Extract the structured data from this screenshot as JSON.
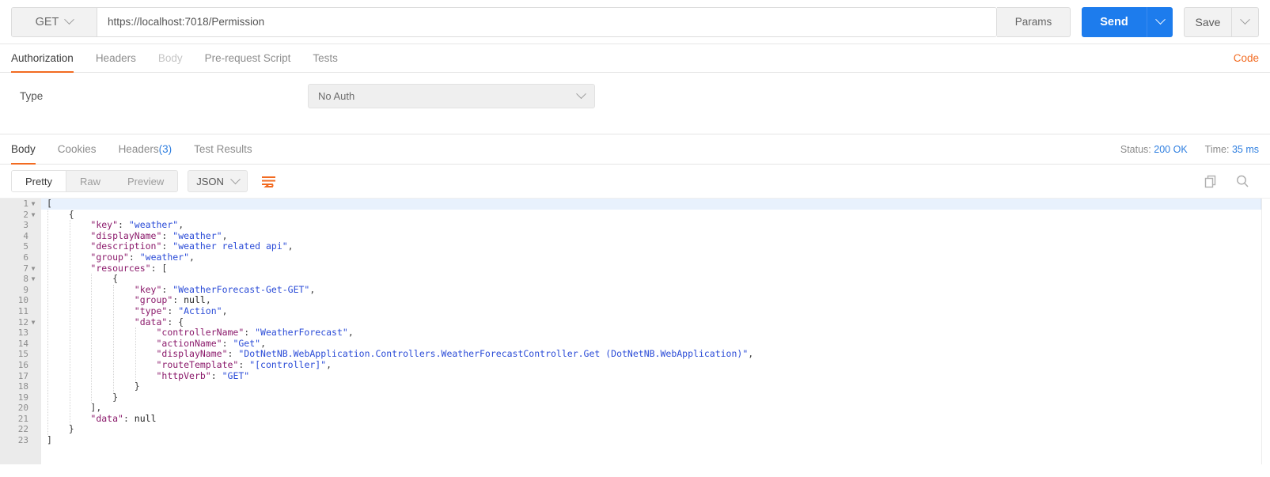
{
  "request": {
    "method": "GET",
    "url": "https://localhost:7018/Permission",
    "params_label": "Params",
    "send_label": "Send",
    "save_label": "Save"
  },
  "request_tabs": [
    {
      "label": "Authorization",
      "state": "active"
    },
    {
      "label": "Headers",
      "state": "normal"
    },
    {
      "label": "Body",
      "state": "muted"
    },
    {
      "label": "Pre-request Script",
      "state": "normal"
    },
    {
      "label": "Tests",
      "state": "normal"
    }
  ],
  "code_link": "Code",
  "auth": {
    "type_label": "Type",
    "type_value": "No Auth"
  },
  "response_tabs": [
    {
      "label": "Body",
      "state": "active",
      "count": ""
    },
    {
      "label": "Cookies",
      "state": "normal",
      "count": ""
    },
    {
      "label": "Headers",
      "state": "normal",
      "count": "(3)"
    },
    {
      "label": "Test Results",
      "state": "normal",
      "count": ""
    }
  ],
  "response_meta": {
    "status_label": "Status:",
    "status_value": "200 OK",
    "time_label": "Time:",
    "time_value": "35 ms"
  },
  "body_toolbar": {
    "views": [
      {
        "label": "Pretty",
        "state": "active"
      },
      {
        "label": "Raw",
        "state": "normal"
      },
      {
        "label": "Preview",
        "state": "normal"
      }
    ],
    "format": "JSON",
    "wrap_icon": "wrap-lines-icon",
    "copy_icon": "copy-icon",
    "search_icon": "search-icon"
  },
  "colors": {
    "accent_orange": "#f26b21",
    "send_blue": "#1d7ced",
    "link_blue": "#2f7fe0",
    "json_key": "#8b1a6b",
    "json_string": "#2a4bd7",
    "line_highlight": "#e8f1fd"
  },
  "editor": {
    "highlighted_line": 1,
    "fold_lines": [
      1,
      2,
      7,
      8,
      12
    ],
    "lines": [
      {
        "n": 1,
        "indent": 0,
        "tokens": [
          {
            "t": "p",
            "v": "["
          }
        ]
      },
      {
        "n": 2,
        "indent": 1,
        "tokens": [
          {
            "t": "p",
            "v": "{"
          }
        ]
      },
      {
        "n": 3,
        "indent": 2,
        "tokens": [
          {
            "t": "k",
            "v": "\"key\""
          },
          {
            "t": "p",
            "v": ": "
          },
          {
            "t": "s",
            "v": "\"weather\""
          },
          {
            "t": "p",
            "v": ","
          }
        ]
      },
      {
        "n": 4,
        "indent": 2,
        "tokens": [
          {
            "t": "k",
            "v": "\"displayName\""
          },
          {
            "t": "p",
            "v": ": "
          },
          {
            "t": "s",
            "v": "\"weather\""
          },
          {
            "t": "p",
            "v": ","
          }
        ]
      },
      {
        "n": 5,
        "indent": 2,
        "tokens": [
          {
            "t": "k",
            "v": "\"description\""
          },
          {
            "t": "p",
            "v": ": "
          },
          {
            "t": "s",
            "v": "\"weather related api\""
          },
          {
            "t": "p",
            "v": ","
          }
        ]
      },
      {
        "n": 6,
        "indent": 2,
        "tokens": [
          {
            "t": "k",
            "v": "\"group\""
          },
          {
            "t": "p",
            "v": ": "
          },
          {
            "t": "s",
            "v": "\"weather\""
          },
          {
            "t": "p",
            "v": ","
          }
        ]
      },
      {
        "n": 7,
        "indent": 2,
        "tokens": [
          {
            "t": "k",
            "v": "\"resources\""
          },
          {
            "t": "p",
            "v": ": ["
          }
        ]
      },
      {
        "n": 8,
        "indent": 3,
        "tokens": [
          {
            "t": "p",
            "v": "{"
          }
        ]
      },
      {
        "n": 9,
        "indent": 4,
        "tokens": [
          {
            "t": "k",
            "v": "\"key\""
          },
          {
            "t": "p",
            "v": ": "
          },
          {
            "t": "s",
            "v": "\"WeatherForecast-Get-GET\""
          },
          {
            "t": "p",
            "v": ","
          }
        ]
      },
      {
        "n": 10,
        "indent": 4,
        "tokens": [
          {
            "t": "k",
            "v": "\"group\""
          },
          {
            "t": "p",
            "v": ": "
          },
          {
            "t": "n",
            "v": "null"
          },
          {
            "t": "p",
            "v": ","
          }
        ]
      },
      {
        "n": 11,
        "indent": 4,
        "tokens": [
          {
            "t": "k",
            "v": "\"type\""
          },
          {
            "t": "p",
            "v": ": "
          },
          {
            "t": "s",
            "v": "\"Action\""
          },
          {
            "t": "p",
            "v": ","
          }
        ]
      },
      {
        "n": 12,
        "indent": 4,
        "tokens": [
          {
            "t": "k",
            "v": "\"data\""
          },
          {
            "t": "p",
            "v": ": {"
          }
        ]
      },
      {
        "n": 13,
        "indent": 5,
        "tokens": [
          {
            "t": "k",
            "v": "\"controllerName\""
          },
          {
            "t": "p",
            "v": ": "
          },
          {
            "t": "s",
            "v": "\"WeatherForecast\""
          },
          {
            "t": "p",
            "v": ","
          }
        ]
      },
      {
        "n": 14,
        "indent": 5,
        "tokens": [
          {
            "t": "k",
            "v": "\"actionName\""
          },
          {
            "t": "p",
            "v": ": "
          },
          {
            "t": "s",
            "v": "\"Get\""
          },
          {
            "t": "p",
            "v": ","
          }
        ]
      },
      {
        "n": 15,
        "indent": 5,
        "tokens": [
          {
            "t": "k",
            "v": "\"displayName\""
          },
          {
            "t": "p",
            "v": ": "
          },
          {
            "t": "s",
            "v": "\"DotNetNB.WebApplication.Controllers.WeatherForecastController.Get (DotNetNB.WebApplication)\""
          },
          {
            "t": "p",
            "v": ","
          }
        ]
      },
      {
        "n": 16,
        "indent": 5,
        "tokens": [
          {
            "t": "k",
            "v": "\"routeTemplate\""
          },
          {
            "t": "p",
            "v": ": "
          },
          {
            "t": "s",
            "v": "\"[controller]\""
          },
          {
            "t": "p",
            "v": ","
          }
        ]
      },
      {
        "n": 17,
        "indent": 5,
        "tokens": [
          {
            "t": "k",
            "v": "\"httpVerb\""
          },
          {
            "t": "p",
            "v": ": "
          },
          {
            "t": "s",
            "v": "\"GET\""
          }
        ]
      },
      {
        "n": 18,
        "indent": 4,
        "tokens": [
          {
            "t": "p",
            "v": "}"
          }
        ]
      },
      {
        "n": 19,
        "indent": 3,
        "tokens": [
          {
            "t": "p",
            "v": "}"
          }
        ]
      },
      {
        "n": 20,
        "indent": 2,
        "tokens": [
          {
            "t": "p",
            "v": "],"
          }
        ]
      },
      {
        "n": 21,
        "indent": 2,
        "tokens": [
          {
            "t": "k",
            "v": "\"data\""
          },
          {
            "t": "p",
            "v": ": "
          },
          {
            "t": "n",
            "v": "null"
          }
        ]
      },
      {
        "n": 22,
        "indent": 1,
        "tokens": [
          {
            "t": "p",
            "v": "}"
          }
        ]
      },
      {
        "n": 23,
        "indent": 0,
        "tokens": [
          {
            "t": "p",
            "v": "]"
          }
        ]
      }
    ]
  }
}
